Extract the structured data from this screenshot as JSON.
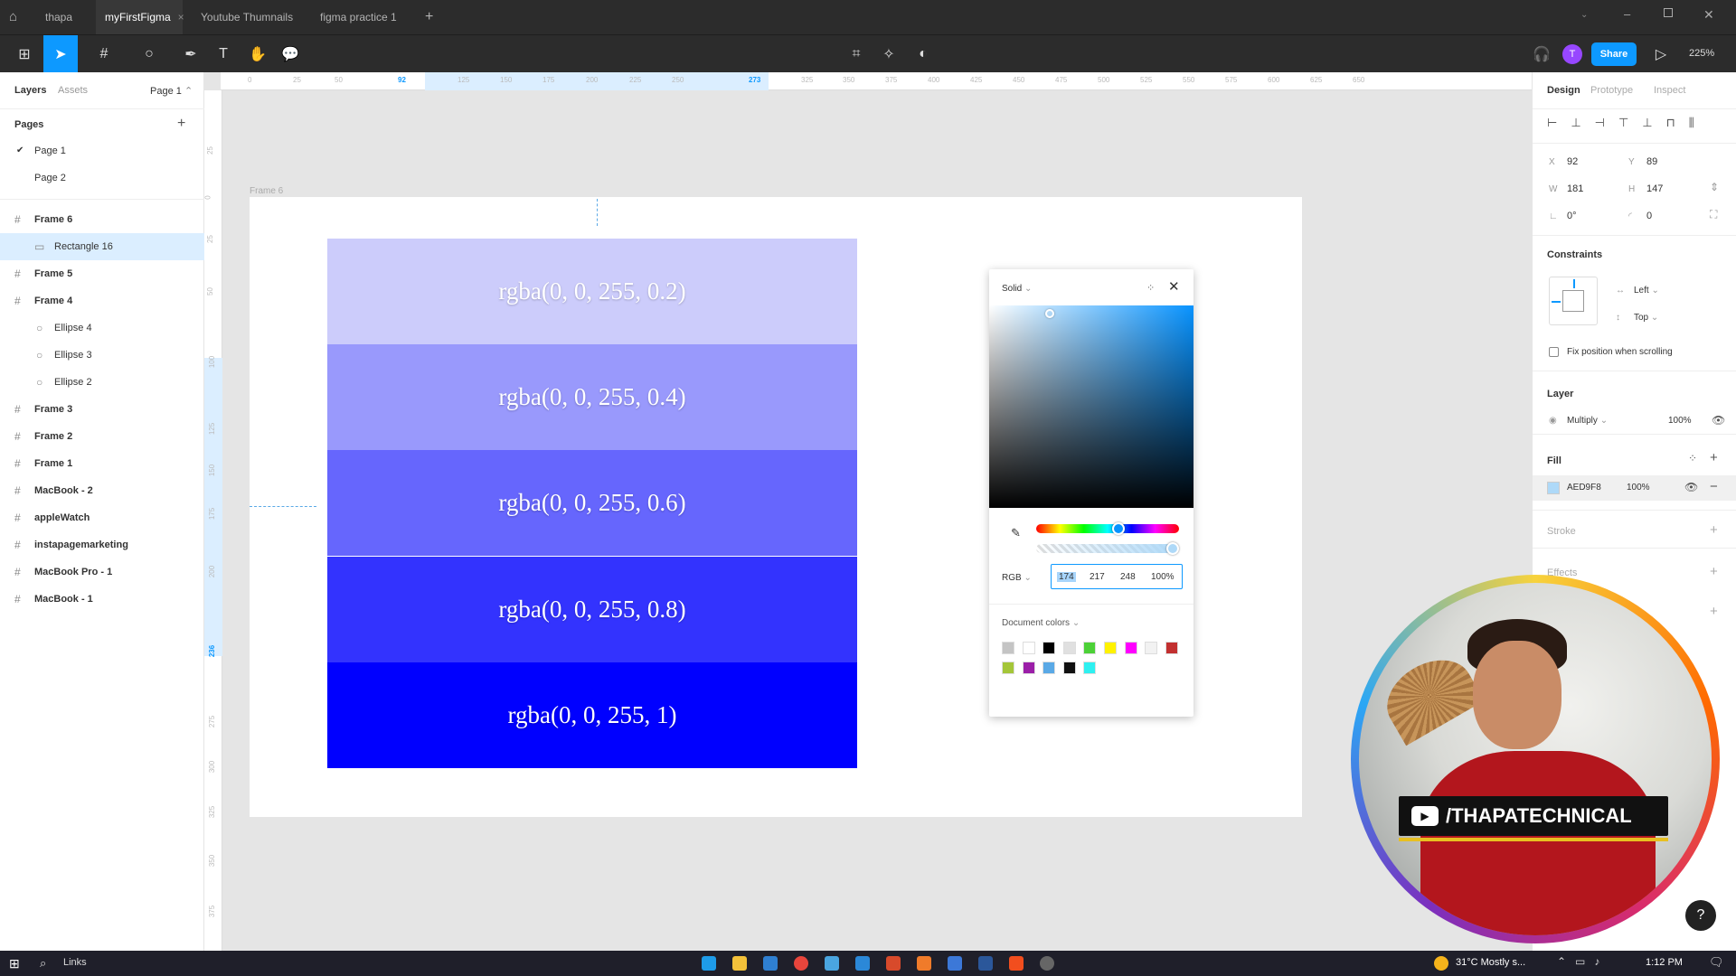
{
  "titlebar": {
    "tabs": [
      "thapa",
      "myFirstFigma",
      "Youtube Thumnails",
      "figma practice 1"
    ],
    "active_tab": 1
  },
  "toolbar": {
    "zoom": "225%",
    "share_label": "Share",
    "user_initial": "T"
  },
  "left_panel": {
    "tab_layers": "Layers",
    "tab_assets": "Assets",
    "page_selector": "Page 1",
    "pages_heading": "Pages",
    "pages": [
      "Page 1",
      "Page 2"
    ],
    "layers": [
      {
        "name": "Frame 6",
        "kind": "frame"
      },
      {
        "name": "Rectangle 16",
        "kind": "rect",
        "selected": true
      },
      {
        "name": "Frame 5",
        "kind": "frame"
      },
      {
        "name": "Frame 4",
        "kind": "frame"
      },
      {
        "name": "Ellipse 4",
        "kind": "ellipse"
      },
      {
        "name": "Ellipse 3",
        "kind": "ellipse"
      },
      {
        "name": "Ellipse 2",
        "kind": "ellipse"
      },
      {
        "name": "Frame 3",
        "kind": "frame"
      },
      {
        "name": "Frame 2",
        "kind": "frame"
      },
      {
        "name": "Frame 1",
        "kind": "frame"
      },
      {
        "name": "MacBook - 2",
        "kind": "frame"
      },
      {
        "name": "appleWatch",
        "kind": "frame"
      },
      {
        "name": "instapagemarketing",
        "kind": "frame"
      },
      {
        "name": "MacBook Pro - 1",
        "kind": "frame"
      },
      {
        "name": "MacBook - 1",
        "kind": "frame"
      }
    ]
  },
  "ruler": {
    "top_ticks": [
      "0",
      "25",
      "50",
      "92",
      "125",
      "150",
      "175",
      "200",
      "225",
      "250",
      "273",
      "325",
      "350",
      "375",
      "400",
      "425",
      "450",
      "475",
      "500",
      "525",
      "550",
      "575",
      "600",
      "625",
      "650"
    ],
    "left_ticks": [
      "25",
      "0",
      "25",
      "50",
      "100",
      "125",
      "150",
      "175",
      "200",
      "236",
      "275",
      "300",
      "325",
      "350",
      "375"
    ]
  },
  "canvas": {
    "frame_label": "Frame 6",
    "stripes": [
      {
        "label": "rgba(0, 0, 255, 0.2)",
        "color": "#ccccfb"
      },
      {
        "label": "rgba(0, 0, 255, 0.4)",
        "color": "#9999fc"
      },
      {
        "label": "rgba(0, 0, 255, 0.6)",
        "color": "#6666fd"
      },
      {
        "label": "rgba(0, 0, 255, 0.8)",
        "color": "#3333fe"
      },
      {
        "label": "rgba(0, 0, 255, 1)",
        "color": "#0000ff"
      }
    ]
  },
  "color_picker": {
    "mode": "Solid",
    "format": "RGB",
    "r": "174",
    "g": "217",
    "b": "248",
    "alpha": "100%",
    "doc_colors_label": "Document colors",
    "swatches": [
      "#c4c4c4",
      "#ffffff",
      "#000000",
      "#e0e0e0",
      "#4cd137",
      "#fff200",
      "#ff00ff",
      "#f2f2f2",
      "#c23030",
      "#a4c639",
      "#9b1fa8",
      "#5aa9e6",
      "#111111",
      "#2ef0f0"
    ]
  },
  "right_panel": {
    "tabs": [
      "Design",
      "Prototype",
      "Inspect"
    ],
    "x": "92",
    "y": "89",
    "w": "181",
    "h": "147",
    "rotation": "0°",
    "radius": "0",
    "constraints_heading": "Constraints",
    "constraint_h": "Left",
    "constraint_v": "Top",
    "fix_position": "Fix position when scrolling",
    "layer_heading": "Layer",
    "blend_mode": "Multiply",
    "layer_opacity": "100%",
    "fill_heading": "Fill",
    "fill_hex": "AED9F8",
    "fill_opacity": "100%",
    "fill_color": "#aed9f8",
    "stroke_heading": "Stroke",
    "effects_heading": "Effects"
  },
  "webcam": {
    "channel": "/THAPATECHNICAL"
  },
  "taskbar": {
    "search_label": "Links",
    "weather": "31°C  Mostly s...",
    "time": "1:12 PM"
  }
}
